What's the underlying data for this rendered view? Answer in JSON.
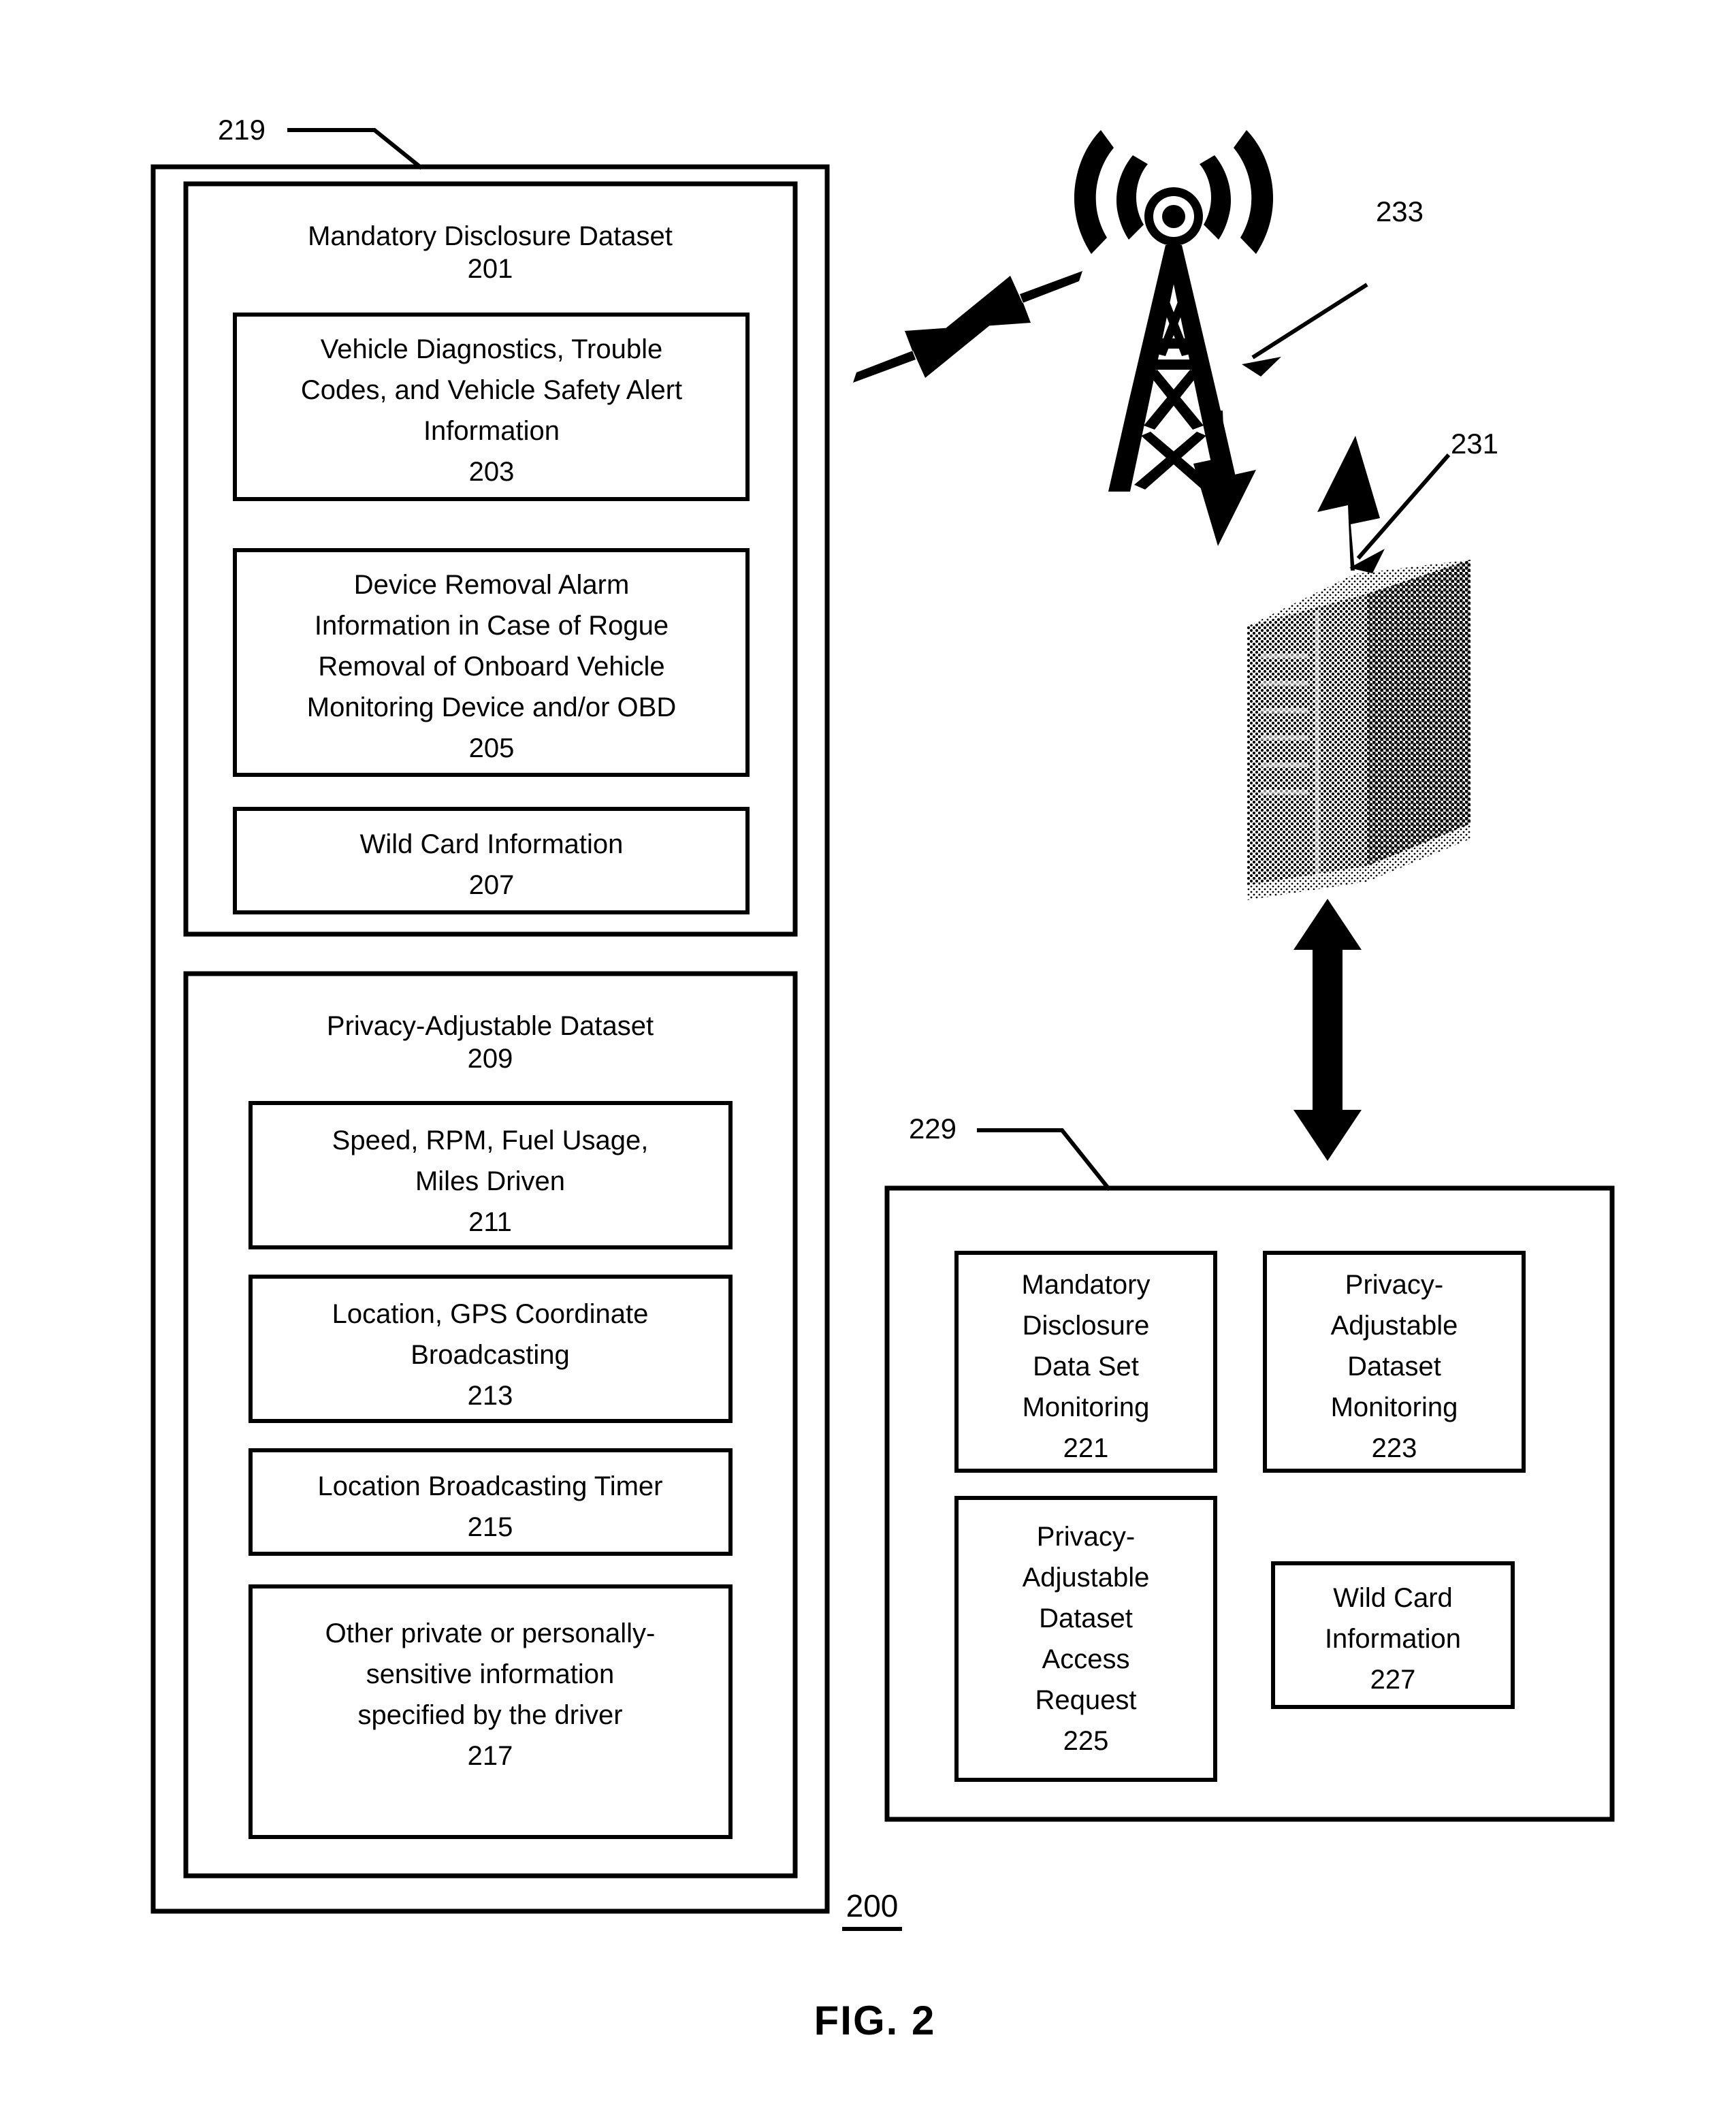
{
  "figure": {
    "figure_label": "FIG. 2",
    "system_reference": "200"
  },
  "left_container": {
    "reference": "219",
    "mandatory_dataset": {
      "title": "Mandatory Disclosure Dataset",
      "reference": "201",
      "items": [
        {
          "lines": [
            "Vehicle Diagnostics, Trouble",
            "Codes, and Vehicle Safety Alert",
            "Information"
          ],
          "reference": "203"
        },
        {
          "lines": [
            "Device Removal Alarm",
            "Information in Case of Rogue",
            "Removal of Onboard Vehicle",
            "Monitoring Device and/or OBD"
          ],
          "reference": "205"
        },
        {
          "lines": [
            "Wild Card Information"
          ],
          "reference": "207"
        }
      ]
    },
    "privacy_dataset": {
      "title": "Privacy-Adjustable Dataset",
      "reference": "209",
      "items": [
        {
          "lines": [
            "Speed, RPM, Fuel Usage,",
            "Miles Driven"
          ],
          "reference": "211"
        },
        {
          "lines": [
            "Location, GPS Coordinate",
            "Broadcasting"
          ],
          "reference": "213"
        },
        {
          "lines": [
            "Location Broadcasting Timer"
          ],
          "reference": "215"
        },
        {
          "lines": [
            "Other private or personally-",
            "sensitive information",
            "specified by the driver"
          ],
          "reference": "217"
        }
      ]
    }
  },
  "network": {
    "tower": {
      "reference": "233",
      "icon": "cell-tower-icon"
    },
    "server": {
      "reference": "231",
      "icon": "server-icon"
    }
  },
  "right_container": {
    "reference": "229",
    "items": [
      {
        "lines": [
          "Mandatory",
          "Disclosure",
          "Data Set",
          "Monitoring"
        ],
        "reference": "221"
      },
      {
        "lines": [
          "Privacy-",
          "Adjustable",
          "Dataset",
          "Monitoring"
        ],
        "reference": "223"
      },
      {
        "lines": [
          "Privacy-",
          "Adjustable",
          "Dataset",
          "Access",
          "Request"
        ],
        "reference": "225"
      },
      {
        "lines": [
          "Wild Card",
          "Information"
        ],
        "reference": "227"
      }
    ]
  },
  "colors": {
    "ink": "#000000",
    "paper": "#ffffff"
  }
}
